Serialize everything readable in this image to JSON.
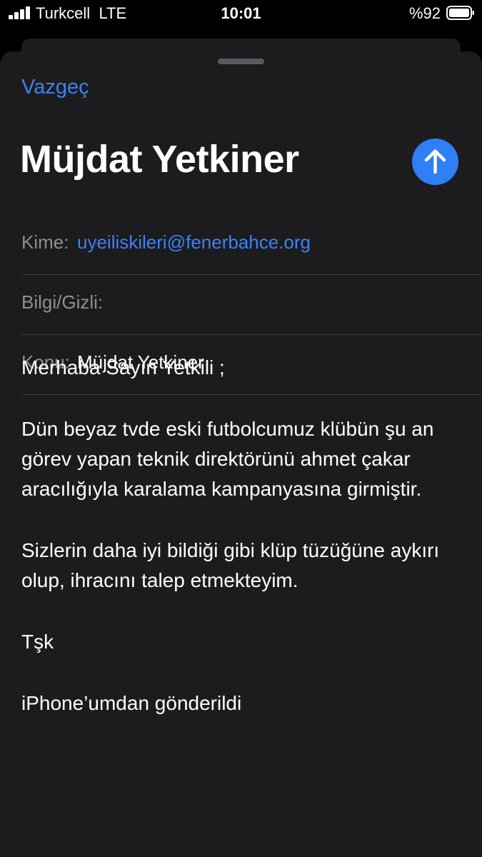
{
  "status_bar": {
    "carrier": "Turkcell",
    "network": "LTE",
    "time": "10:01",
    "battery_percent": "%92",
    "battery_level": 0.92,
    "signal_icon": "cellular-signal-icon",
    "battery_icon": "battery-icon"
  },
  "compose": {
    "cancel_label": "Vazgeç",
    "title": "Müjdat Yetkiner",
    "send_icon": "arrow-up-icon",
    "accent_color": "#2f7ff5",
    "to_label": "Kime:",
    "to_value": "uyeiliskileri@fenerbahce.org",
    "cc_label": "Bilgi/Gizli:",
    "subject_label": "Konu:",
    "subject_value": "Müjdat Yetkiner"
  },
  "body": {
    "paragraphs": [
      "Merhaba Sayın Yetkili ;",
      "Dün beyaz tvde eski futbolcumuz klübün şu an görev yapan teknik direktörünü ahmet çakar aracılığıyla karalama kampanyasına girmiştir.",
      "Sizlerin daha iyi bildiği gibi klüp tüzüğüne aykırı olup, ihracını talep etmekteyim.",
      "Tşk",
      "iPhone’umdan gönderildi"
    ]
  }
}
